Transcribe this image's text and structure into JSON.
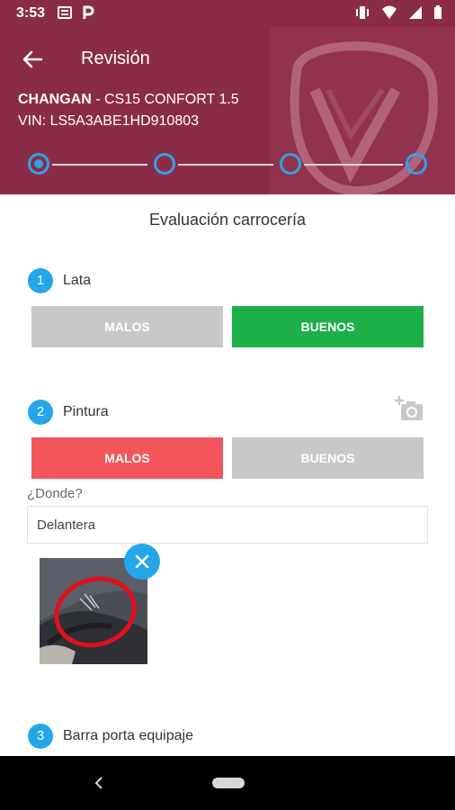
{
  "status_bar": {
    "time": "3:53"
  },
  "app_bar": {
    "title": "Revisión"
  },
  "vehicle": {
    "brand": "CHANGAN",
    "model": " - CS15 CONFORT 1.5",
    "vin": "VIN: LS5A3ABE1HD910803"
  },
  "stepper": {
    "total_steps": 4,
    "current_step": 1
  },
  "section": {
    "title": "Evaluación carrocería"
  },
  "questions": [
    {
      "number": "1",
      "label": "Lata",
      "bad_label": "MALOS",
      "good_label": "BUENOS",
      "selected": "BUENOS"
    },
    {
      "number": "2",
      "label": "Pintura",
      "bad_label": "MALOS",
      "good_label": "BUENOS",
      "selected": "MALOS",
      "where_label": "¿Donde?",
      "where_value": "Delantera"
    },
    {
      "number": "3",
      "label": "Barra porta equipaje"
    }
  ],
  "colors": {
    "header": "#8a2c48",
    "accent": "#24a6e9",
    "good_selected": "#1daf4a",
    "bad_selected": "#f3565a",
    "unselected": "#c8c8c8"
  },
  "icons": [
    "back-arrow-icon",
    "add-photo-icon",
    "close-icon",
    "nav-back-icon"
  ]
}
